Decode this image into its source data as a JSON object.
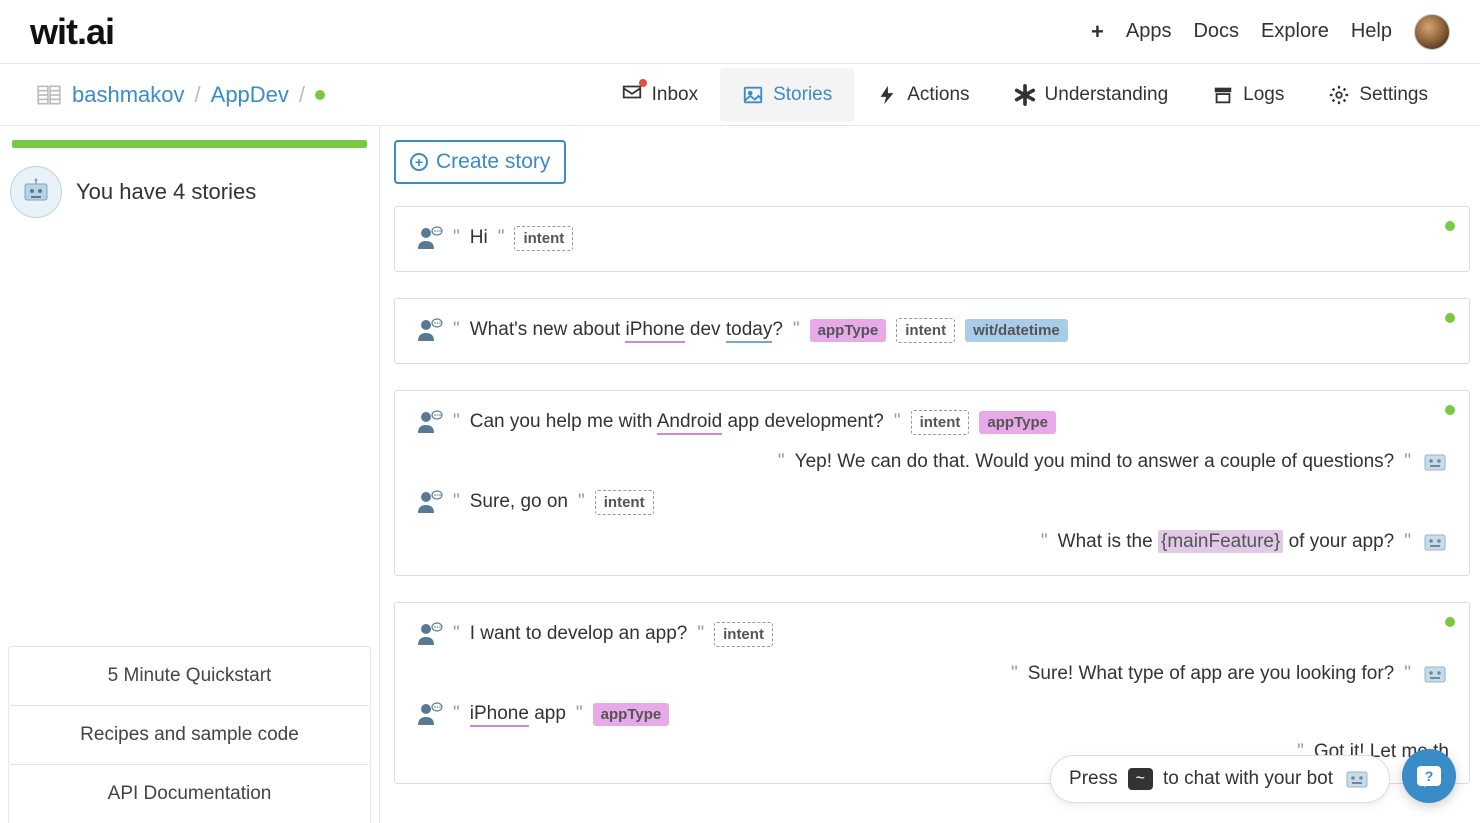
{
  "header": {
    "logo": "wit.ai",
    "nav": {
      "apps": "Apps",
      "docs": "Docs",
      "explore": "Explore",
      "help": "Help"
    }
  },
  "breadcrumb": {
    "user": "bashmakov",
    "app": "AppDev"
  },
  "mainnav": {
    "inbox": "Inbox",
    "stories": "Stories",
    "actions": "Actions",
    "understanding": "Understanding",
    "logs": "Logs",
    "settings": "Settings"
  },
  "sidebar": {
    "count_text": "You have 4 stories",
    "footer": {
      "quickstart": "5 Minute Quickstart",
      "recipes": "Recipes and sample code",
      "apidocs": "API Documentation"
    }
  },
  "create_label": "Create story",
  "tags": {
    "intent": "intent",
    "appType": "appType",
    "datetime": "wit/datetime"
  },
  "stories": {
    "s1": {
      "u1_a": "Hi"
    },
    "s2": {
      "u1_a": "What's new about ",
      "u1_b": "iPhone",
      "u1_c": " dev ",
      "u1_d": "today",
      "u1_e": "?"
    },
    "s3": {
      "u1_a": "Can you help me with ",
      "u1_b": "Android",
      "u1_c": " app development?",
      "b1": "Yep! We can do that. Would you mind to answer a couple of questions?",
      "u2": "Sure, go on",
      "b2_a": "What is the ",
      "b2_b": "{mainFeature}",
      "b2_c": " of your app?"
    },
    "s4": {
      "u1": "I want to develop an app?",
      "b1": "Sure! What type of app are you looking for?",
      "u2_a": "iPhone",
      "u2_b": " app",
      "b2": "Got it! Let me th"
    }
  },
  "chat_pill": {
    "press": "Press",
    "key": "~",
    "rest": "to chat with your bot"
  }
}
